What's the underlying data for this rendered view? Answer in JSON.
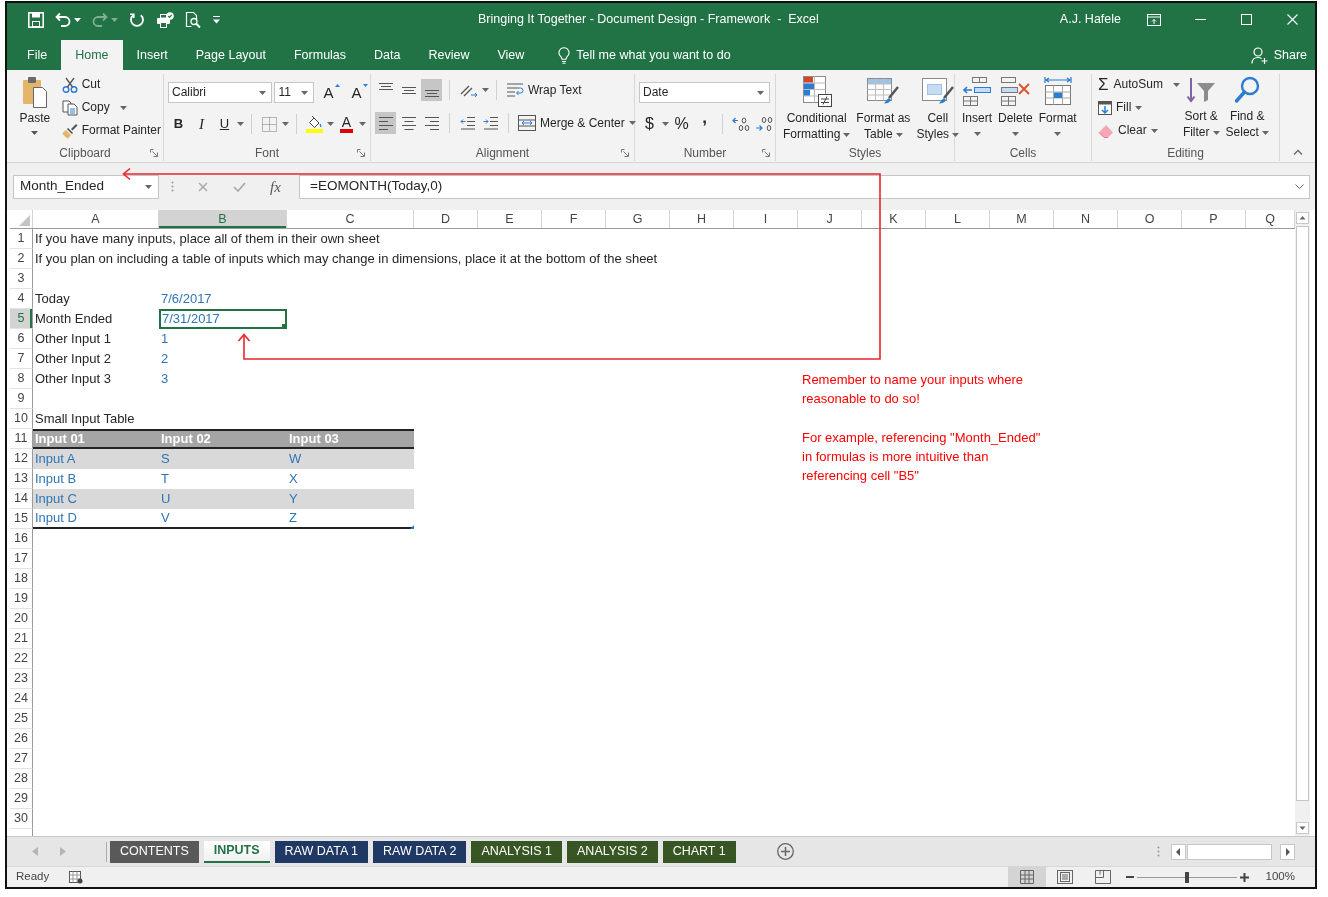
{
  "window": {
    "title": "Bringing It Together - Document Design - Framework  -  Excel",
    "user": "A.J. Hafele"
  },
  "quick_access": [
    {
      "kind": "save",
      "disabled": false
    },
    {
      "kind": "undo",
      "disabled": false
    },
    {
      "kind": "redo",
      "disabled": true
    },
    {
      "kind": "refresh",
      "disabled": false
    },
    {
      "kind": "print",
      "disabled": false
    },
    {
      "kind": "preview",
      "disabled": false
    },
    {
      "kind": "customize",
      "disabled": false
    }
  ],
  "ribbon_tabs": [
    {
      "label": "File",
      "selected": false
    },
    {
      "label": "Home",
      "selected": true
    },
    {
      "label": "Insert",
      "selected": false
    },
    {
      "label": "Page Layout",
      "selected": false
    },
    {
      "label": "Formulas",
      "selected": false
    },
    {
      "label": "Data",
      "selected": false
    },
    {
      "label": "Review",
      "selected": false
    },
    {
      "label": "View",
      "selected": false
    }
  ],
  "tell_me": {
    "placeholder": "Tell me what you want to do"
  },
  "share": {
    "label": "Share"
  },
  "ribbon": {
    "clipboard": {
      "label": "Clipboard",
      "paste": "Paste",
      "cut": "Cut",
      "copy": "Copy",
      "format_painter": "Format Painter"
    },
    "font": {
      "label": "Font",
      "font_name": "Calibri",
      "font_size": "11",
      "grow": "A",
      "shrink": "A",
      "bold": "B",
      "italic": "I",
      "underline": "U",
      "font_color": "A"
    },
    "alignment": {
      "label": "Alignment",
      "vertical": [
        {
          "kind": "top",
          "selected": false
        },
        {
          "kind": "middle",
          "selected": false
        },
        {
          "kind": "bottom",
          "selected": true
        }
      ],
      "horizontal": [
        {
          "kind": "left",
          "selected": true
        },
        {
          "kind": "center",
          "selected": false
        },
        {
          "kind": "right",
          "selected": false
        }
      ],
      "wrap_text": "Wrap Text",
      "merge_center": "Merge & Center"
    },
    "number": {
      "label": "Number",
      "format": "Date",
      "currency": "$",
      "percent": "%",
      "comma": ","
    },
    "styles": {
      "label": "Styles",
      "buttons": [
        {
          "kind": "conditional",
          "lines": [
            "Conditional",
            "Formatting"
          ]
        },
        {
          "kind": "table",
          "lines": [
            "Format as",
            "Table"
          ]
        },
        {
          "kind": "cell",
          "lines": [
            "Cell",
            "Styles"
          ]
        }
      ]
    },
    "cells": {
      "label": "Cells",
      "buttons": [
        {
          "kind": "insert",
          "label": "Insert"
        },
        {
          "kind": "delete",
          "label": "Delete"
        },
        {
          "kind": "format",
          "label": "Format"
        }
      ]
    },
    "editing": {
      "label": "Editing",
      "autosum_symbol": "Σ",
      "autosum": "AutoSum",
      "fill": "Fill",
      "clear": "Clear",
      "sort_filter": [
        "Sort &",
        "Filter"
      ],
      "find_select": [
        "Find &",
        "Select"
      ]
    }
  },
  "name_box": {
    "value": "Month_Ended"
  },
  "formula_bar": {
    "function_label": "fx",
    "value": "=EOMONTH(Today,0)"
  },
  "columns": [
    {
      "label": "A",
      "selected": false
    },
    {
      "label": "B",
      "selected": true
    },
    {
      "label": "C",
      "selected": false
    },
    {
      "label": "D",
      "selected": false
    },
    {
      "label": "E",
      "selected": false
    },
    {
      "label": "F",
      "selected": false
    },
    {
      "label": "G",
      "selected": false
    },
    {
      "label": "H",
      "selected": false
    },
    {
      "label": "I",
      "selected": false
    },
    {
      "label": "J",
      "selected": false
    },
    {
      "label": "K",
      "selected": false
    },
    {
      "label": "L",
      "selected": false
    },
    {
      "label": "M",
      "selected": false
    },
    {
      "label": "N",
      "selected": false
    },
    {
      "label": "O",
      "selected": false
    },
    {
      "label": "P",
      "selected": false
    },
    {
      "label": "Q",
      "selected": false
    }
  ],
  "rows": [
    {
      "number": "1",
      "selected": false,
      "kind": "plain",
      "cells": [
        {
          "text": "If you have many inputs, place all of them in their own sheet",
          "kind": "note",
          "selected": false
        }
      ]
    },
    {
      "number": "2",
      "selected": false,
      "kind": "plain",
      "cells": [
        {
          "text": "If you plan on including a table of inputs which may change in dimensions, place it at the bottom of the sheet",
          "kind": "note",
          "selected": false
        }
      ]
    },
    {
      "number": "3",
      "selected": false,
      "kind": "plain"
    },
    {
      "number": "4",
      "selected": false,
      "kind": "plain",
      "cells": [
        {
          "text": "Today",
          "kind": "label",
          "selected": false
        },
        {
          "text": "7/6/2017",
          "kind": "input",
          "selected": false
        }
      ]
    },
    {
      "number": "5",
      "selected": true,
      "kind": "plain",
      "cells": [
        {
          "text": "Month Ended",
          "kind": "label",
          "selected": false
        },
        {
          "text": "7/31/2017",
          "kind": "input",
          "selected": true
        }
      ]
    },
    {
      "number": "6",
      "selected": false,
      "kind": "plain",
      "cells": [
        {
          "text": "Other Input 1",
          "kind": "label",
          "selected": false
        },
        {
          "text": "1",
          "kind": "input",
          "selected": false
        }
      ]
    },
    {
      "number": "7",
      "selected": false,
      "kind": "plain",
      "cells": [
        {
          "text": "Other Input 2",
          "kind": "label",
          "selected": false
        },
        {
          "text": "2",
          "kind": "input",
          "selected": false
        }
      ]
    },
    {
      "number": "8",
      "selected": false,
      "kind": "plain",
      "cells": [
        {
          "text": "Other Input 3",
          "kind": "label",
          "selected": false
        },
        {
          "text": "3",
          "kind": "input",
          "selected": false
        }
      ]
    },
    {
      "number": "9",
      "selected": false,
      "kind": "plain"
    },
    {
      "number": "10",
      "selected": false,
      "kind": "plain",
      "cells": [
        {
          "text": "Small Input Table",
          "kind": "label",
          "selected": false
        }
      ]
    },
    {
      "number": "11",
      "selected": false,
      "kind": "table_header",
      "cells": [
        {
          "text": "Input 01",
          "kind": "header",
          "selected": false
        },
        {
          "text": "Input 02",
          "kind": "header",
          "selected": false
        },
        {
          "text": "Input 03",
          "kind": "header",
          "selected": false
        }
      ]
    },
    {
      "number": "12",
      "selected": false,
      "kind": "table_row",
      "banded": true,
      "cells": [
        {
          "text": "Input A",
          "kind": "input",
          "selected": false
        },
        {
          "text": "S",
          "kind": "input",
          "selected": false
        },
        {
          "text": "W",
          "kind": "input",
          "selected": false
        }
      ]
    },
    {
      "number": "13",
      "selected": false,
      "kind": "table_row",
      "banded": false,
      "cells": [
        {
          "text": "Input B",
          "kind": "input",
          "selected": false
        },
        {
          "text": "T",
          "kind": "input",
          "selected": false
        },
        {
          "text": "X",
          "kind": "input",
          "selected": false
        }
      ]
    },
    {
      "number": "14",
      "selected": false,
      "kind": "table_row",
      "banded": true,
      "cells": [
        {
          "text": "Input C",
          "kind": "input",
          "selected": false
        },
        {
          "text": "U",
          "kind": "input",
          "selected": false
        },
        {
          "text": "Y",
          "kind": "input",
          "selected": false
        }
      ]
    },
    {
      "number": "15",
      "selected": false,
      "kind": "table_row",
      "banded": false,
      "cells": [
        {
          "text": "Input D",
          "kind": "input",
          "selected": false
        },
        {
          "text": "V",
          "kind": "input",
          "selected": false
        },
        {
          "text": "Z",
          "kind": "input",
          "selected": false
        }
      ]
    },
    {
      "number": "16",
      "selected": false,
      "kind": "plain"
    },
    {
      "number": "17",
      "selected": false,
      "kind": "plain"
    },
    {
      "number": "18",
      "selected": false,
      "kind": "plain"
    },
    {
      "number": "19",
      "selected": false,
      "kind": "plain"
    },
    {
      "number": "20",
      "selected": false,
      "kind": "plain"
    },
    {
      "number": "21",
      "selected": false,
      "kind": "plain"
    },
    {
      "number": "22",
      "selected": false,
      "kind": "plain"
    },
    {
      "number": "23",
      "selected": false,
      "kind": "plain"
    },
    {
      "number": "24",
      "selected": false,
      "kind": "plain"
    },
    {
      "number": "25",
      "selected": false,
      "kind": "plain"
    },
    {
      "number": "26",
      "selected": false,
      "kind": "plain"
    },
    {
      "number": "27",
      "selected": false,
      "kind": "plain"
    },
    {
      "number": "28",
      "selected": false,
      "kind": "plain"
    },
    {
      "number": "29",
      "selected": false,
      "kind": "plain"
    },
    {
      "number": "30",
      "selected": false,
      "kind": "plain"
    }
  ],
  "annotation": {
    "paragraphs": [
      [
        "Remember to name your inputs where",
        "reasonable to do so!"
      ],
      [
        "For example, referencing \"Month_Ended\"",
        "in formulas is more intuitive than",
        "referencing cell \"B5\""
      ]
    ]
  },
  "sheet_tabs": [
    {
      "label": "CONTENTS",
      "selected": false,
      "color": "#595959"
    },
    {
      "label": "INPUTS",
      "selected": true
    },
    {
      "label": "RAW DATA 1",
      "selected": false,
      "color": "#203864"
    },
    {
      "label": "RAW DATA 2",
      "selected": false,
      "color": "#203864"
    },
    {
      "label": "ANALYSIS 1",
      "selected": false,
      "color": "#375623"
    },
    {
      "label": "ANALYSIS 2",
      "selected": false,
      "color": "#375623"
    },
    {
      "label": "CHART 1",
      "selected": false,
      "color": "#375623"
    }
  ],
  "status_bar": {
    "text": "Ready",
    "views": [
      {
        "kind": "normal",
        "selected": true
      },
      {
        "kind": "page_layout",
        "selected": false
      },
      {
        "kind": "page_break",
        "selected": false
      }
    ],
    "zoom": {
      "level": 0.5,
      "label": "100%"
    }
  }
}
